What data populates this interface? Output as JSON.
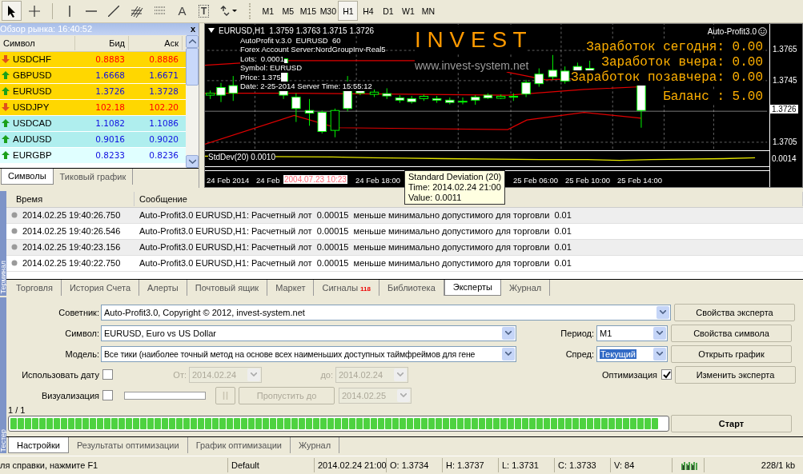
{
  "toolbar": {
    "text_icons": [
      "A",
      "T"
    ],
    "timeframes": [
      {
        "label": "M1",
        "selected": false
      },
      {
        "label": "M5",
        "selected": false
      },
      {
        "label": "M15",
        "selected": false
      },
      {
        "label": "M30",
        "selected": false
      },
      {
        "label": "H1",
        "selected": true
      },
      {
        "label": "H4",
        "selected": false
      },
      {
        "label": "D1",
        "selected": false
      },
      {
        "label": "W1",
        "selected": false
      },
      {
        "label": "MN",
        "selected": false
      }
    ]
  },
  "market_watch": {
    "title": "Обзор рынка: 16:40:52",
    "close": "x",
    "columns": [
      "Символ",
      "Бид",
      "Аск"
    ],
    "rows": [
      {
        "symbol": "USDCHF",
        "bid": "0.8883",
        "ask": "0.8886",
        "kind": "down",
        "color": "#ffd700"
      },
      {
        "symbol": "GBPUSD",
        "bid": "1.6668",
        "ask": "1.6671",
        "kind": "up",
        "color": "#ffd700"
      },
      {
        "symbol": "EURUSD",
        "bid": "1.3726",
        "ask": "1.3728",
        "kind": "up",
        "color": "#ffd700"
      },
      {
        "symbol": "USDJPY",
        "bid": "102.18",
        "ask": "102.20",
        "kind": "down",
        "color": "#ffd700"
      },
      {
        "symbol": "USDCAD",
        "bid": "1.1082",
        "ask": "1.1086",
        "kind": "up",
        "color": "#afeeee"
      },
      {
        "symbol": "AUDUSD",
        "bid": "0.9016",
        "ask": "0.9020",
        "kind": "up",
        "color": "#afeeee"
      },
      {
        "symbol": "EURGBP",
        "bid": "0.8233",
        "ask": "0.8236",
        "kind": "up",
        "color": "#e0ffff"
      }
    ],
    "tabs": [
      {
        "label": "Символы",
        "selected": true
      },
      {
        "label": "Тиковый график",
        "selected": false
      }
    ]
  },
  "chart": {
    "header": "EURUSD,H1  1.3759 1.3763 1.3715 1.3726",
    "expert": "Auto-Profit3.0",
    "comment": [
      "AutoProfit v.3.0  EURUSD  60",
      "Forex Account Server:NordGroupInv-Real5",
      "Lots:  0.0001",
      "Symbol: EURUSD",
      "Price: 1.375",
      "Date: 2-25-2014 Server Time: 15:55:12"
    ],
    "logo": "I N V E S T",
    "url": "www.invest-system.net",
    "stats": [
      "Заработок сегодня: 0.00",
      "Заработок вчера: 0.00",
      "Заработок позавчера: 0.00",
      "Баланс : 5.00"
    ],
    "price_labels": [
      "1.3765",
      "1.3745",
      "1.3705"
    ],
    "current_price": "1.3726",
    "indicator": {
      "label": "StdDev(20) 0.0010",
      "axis": "0.0014"
    },
    "time_labels": [
      "24 Feb 2014",
      "24 Feb",
      "24 Feb 18:00",
      "25 Feb 06:00",
      "25 Feb 10:00",
      "25 Feb 14:00"
    ],
    "cursor_time": "2004.07.23 10:23",
    "tooltip": [
      "Standard Deviation (20)",
      "Time: 2014.02.24 21:00",
      "Value: 0.0011"
    ]
  },
  "terminal": {
    "side_label": "Терминал",
    "columns": [
      "Время",
      "Сообщение"
    ],
    "rows": [
      {
        "time": "2014.02.25 19:40:26.750",
        "message": "Auto-Profit3.0 EURUSD,H1: Расчетный лот  0.00015  меньше минимально допустимого для торговли  0.01"
      },
      {
        "time": "2014.02.25 19:40:26.546",
        "message": "Auto-Profit3.0 EURUSD,H1: Расчетный лот  0.00015  меньше минимально допустимого для торговли  0.01"
      },
      {
        "time": "2014.02.25 19:40:23.156",
        "message": "Auto-Profit3.0 EURUSD,H1: Расчетный лот  0.00015  меньше минимально допустимого для торговли  0.01"
      },
      {
        "time": "2014.02.25 19:40:22.750",
        "message": "Auto-Profit3.0 EURUSD,H1: Расчетный лот  0.00015  меньше минимально допустимого для торговли  0.01"
      }
    ],
    "tabs": [
      {
        "label": "Торговля",
        "selected": false
      },
      {
        "label": "История Счета",
        "selected": false
      },
      {
        "label": "Алерты",
        "selected": false
      },
      {
        "label": "Почтовый ящик",
        "selected": false
      },
      {
        "label": "Маркет",
        "selected": false
      },
      {
        "label": "Сигналы",
        "selected": false,
        "badge": "118"
      },
      {
        "label": "Библиотека",
        "selected": false
      },
      {
        "label": "Эксперты",
        "selected": true
      },
      {
        "label": "Журнал",
        "selected": false
      }
    ]
  },
  "tester": {
    "side_label": "Тестер",
    "expert": {
      "label": "Советник:",
      "value": "Auto-Profit3.0, Copyright © 2012, invest-system.net",
      "button": "Свойства эксперта"
    },
    "symbol": {
      "label": "Символ:",
      "value": "EURUSD, Euro vs US Dollar",
      "button": "Свойства символа"
    },
    "period": {
      "label": "Период:",
      "value": "M1"
    },
    "model": {
      "label": "Модель:",
      "value": "Все тики (наиболее точный метод на основе всех наименьших доступных таймфреймов для гене",
      "button": "Открыть график"
    },
    "spread": {
      "label": "Спред:",
      "value": "Текущий"
    },
    "use_date": {
      "label": "Использовать дату",
      "checked": false
    },
    "from": {
      "label": "От:",
      "value": "2014.02.24",
      "disabled": true
    },
    "to": {
      "label": "до:",
      "value": "2014.02.24",
      "disabled": true
    },
    "optimization": {
      "label": "Оптимизация",
      "checked": true
    },
    "edit_button": "Изменить эксперта",
    "visualization": {
      "label": "Визуализация",
      "checked": false
    },
    "pause_disabled": true,
    "skip": {
      "label": "Пропустить до",
      "disabled": true
    },
    "skip_date": {
      "value": "2014.02.25",
      "disabled": true
    },
    "counter": "1 / 1",
    "progress": {
      "level": 1
    },
    "start": "Старт",
    "tabs": [
      {
        "label": "Настройки",
        "selected": true
      },
      {
        "label": "Результаты оптимизации",
        "selected": false
      },
      {
        "label": "График оптимизации",
        "selected": false
      },
      {
        "label": "Журнал",
        "selected": false
      }
    ]
  },
  "status_bar": [
    "ля справки, нажмите F1",
    "Default",
    "2014.02.24 21:00",
    "O: 1.3734",
    "H: 1.3737",
    "L: 1.3731",
    "C: 1.3733",
    "V: 84",
    "228/1 kb"
  ]
}
